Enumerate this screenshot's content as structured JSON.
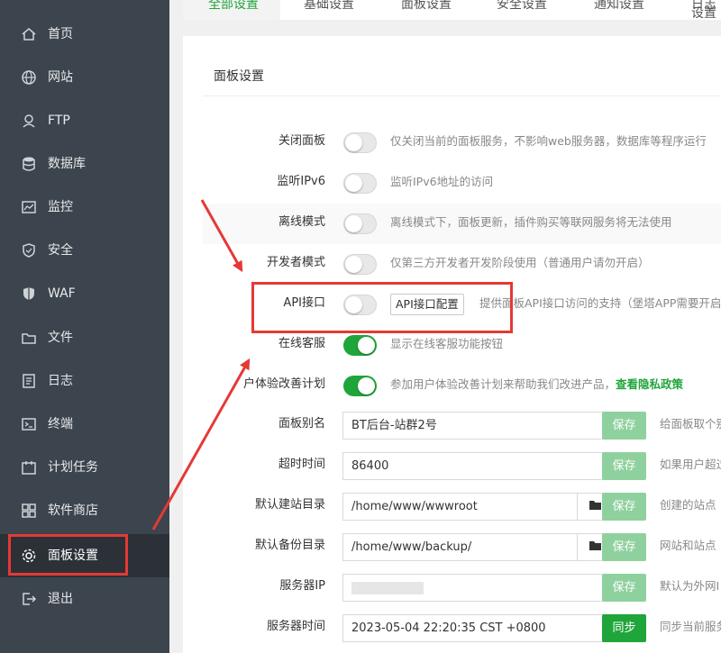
{
  "sidebar": {
    "items": [
      {
        "label": "首页",
        "icon": "home-icon"
      },
      {
        "label": "网站",
        "icon": "globe-icon"
      },
      {
        "label": "FTP",
        "icon": "ftp-icon"
      },
      {
        "label": "数据库",
        "icon": "database-icon"
      },
      {
        "label": "监控",
        "icon": "monitor-icon"
      },
      {
        "label": "安全",
        "icon": "shield-icon"
      },
      {
        "label": "WAF",
        "icon": "waf-shield-icon"
      },
      {
        "label": "文件",
        "icon": "folder-icon"
      },
      {
        "label": "日志",
        "icon": "log-icon"
      },
      {
        "label": "终端",
        "icon": "terminal-icon"
      },
      {
        "label": "计划任务",
        "icon": "calendar-icon"
      },
      {
        "label": "软件商店",
        "icon": "apps-icon"
      },
      {
        "label": "面板设置",
        "icon": "gear-icon",
        "active": true
      },
      {
        "label": "退出",
        "icon": "logout-icon"
      }
    ]
  },
  "tabs": [
    {
      "label": "全部设置",
      "active": true
    },
    {
      "label": "基础设置"
    },
    {
      "label": "面板设置"
    },
    {
      "label": "安全设置"
    },
    {
      "label": "通知设置"
    },
    {
      "label": "日志设置"
    }
  ],
  "panel": {
    "title": "面板设置",
    "toggles": [
      {
        "label": "关闭面板",
        "on": false,
        "desc": "仅关闭当前的面板服务，不影响web服务器，数据库等程序运行"
      },
      {
        "label": "监听IPv6",
        "on": false,
        "desc": "监听IPv6地址的访问"
      },
      {
        "label": "离线模式",
        "on": false,
        "desc": "离线模式下，面板更新，插件购买等联网服务将无法使用"
      },
      {
        "label": "开发者模式",
        "on": false,
        "desc": "仅第三方开发者开发阶段使用（普通用户请勿开启）"
      },
      {
        "label": "API接口",
        "on": false,
        "button": "API接口配置",
        "desc": "提供面板API接口访问的支持（堡塔APP需要开启"
      },
      {
        "label": "在线客服",
        "on": true,
        "desc": "显示在线客服功能按钮"
      },
      {
        "label": "户体验改善计划",
        "on": true,
        "desc": "参加用户体验改善计划来帮助我们改进产品，",
        "link": "查看隐私政策"
      }
    ],
    "fields": [
      {
        "label": "面板别名",
        "value": "BT后台-站群2号",
        "button": "保存",
        "hint": "给面板取个别"
      },
      {
        "label": "超时时间",
        "value": "86400",
        "button": "保存",
        "hint": "如果用户超过"
      },
      {
        "label": "默认建站目录",
        "value": "/home/www/wwwroot",
        "folder": true,
        "button": "保存",
        "hint": "创建的站点"
      },
      {
        "label": "默认备份目录",
        "value": "/home/www/backup/",
        "folder": true,
        "button": "保存",
        "hint": "网站和站点"
      },
      {
        "label": "服务器IP",
        "value": "",
        "blurred": true,
        "button": "保存",
        "hint": "默认为外网I"
      },
      {
        "label": "服务器时间",
        "value": "2023-05-04 22:20:35 CST +0800",
        "button": "同步",
        "solid": true,
        "hint": "同步当前服务"
      }
    ]
  },
  "colors": {
    "accent": "#20a53a",
    "highlight": "#e53935",
    "sidebar": "#3c444d"
  }
}
